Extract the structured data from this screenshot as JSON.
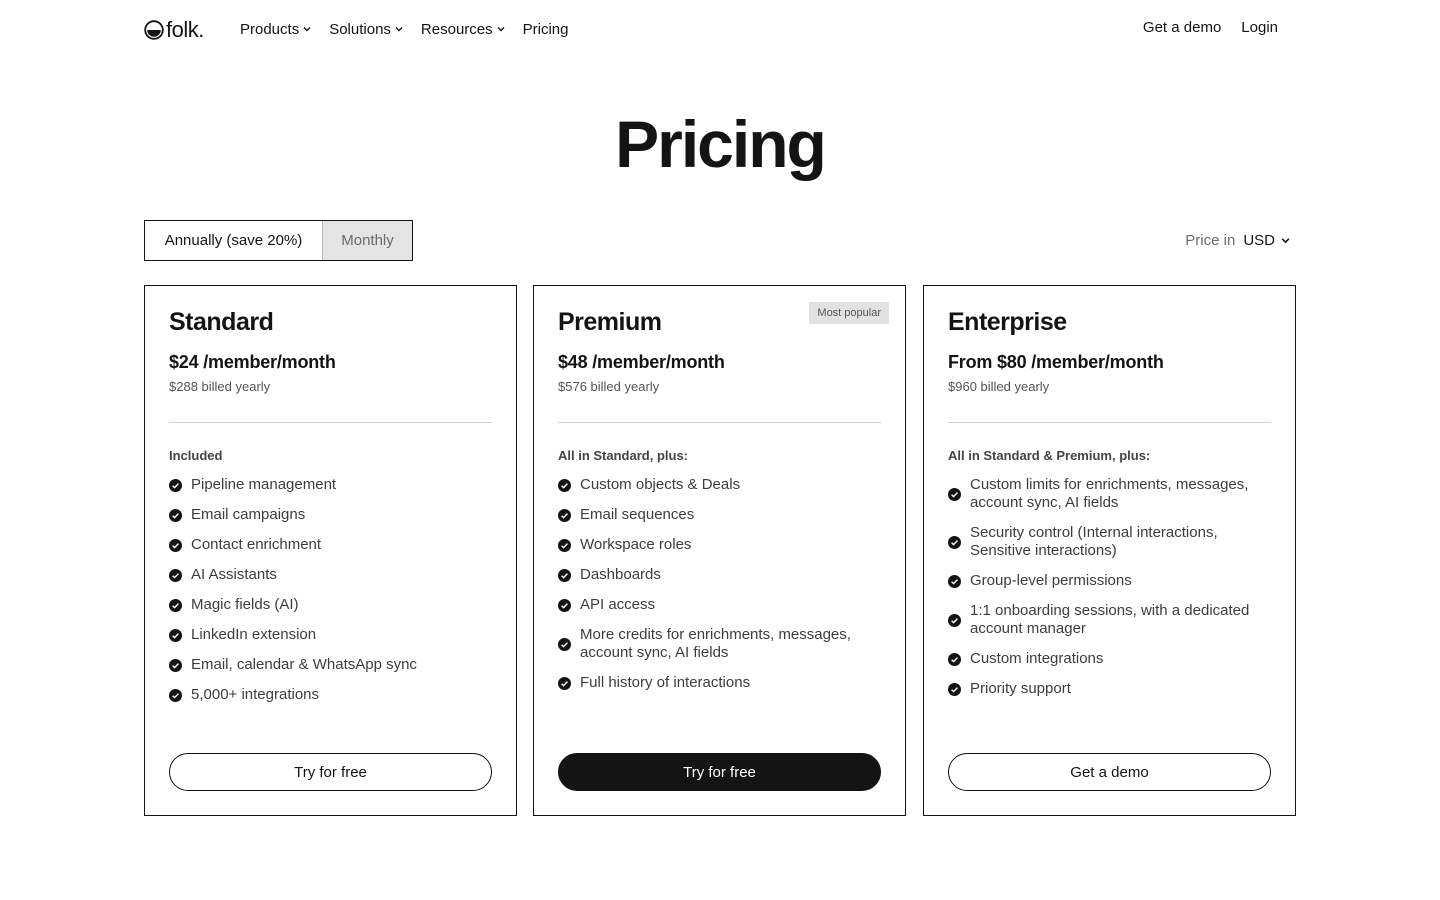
{
  "brand": {
    "logo_text": "folk."
  },
  "nav": {
    "items": [
      {
        "label": "Products",
        "has_dropdown": true
      },
      {
        "label": "Solutions",
        "has_dropdown": true
      },
      {
        "label": "Resources",
        "has_dropdown": true
      },
      {
        "label": "Pricing",
        "has_dropdown": false
      }
    ],
    "right": {
      "demo": "Get a demo",
      "login": "Login"
    }
  },
  "page": {
    "title": "Pricing"
  },
  "billing_toggle": {
    "annual": "Annually (save 20%)",
    "monthly": "Monthly",
    "selected": "annual"
  },
  "currency": {
    "label": "Price in",
    "value": "USD"
  },
  "plans": [
    {
      "name": "Standard",
      "price": "$24 /member/month",
      "billed": "$288 billed yearly",
      "features_heading": "Included",
      "features": [
        "Pipeline management",
        "Email campaigns",
        "Contact enrichment",
        "AI Assistants",
        "Magic fields (AI)",
        "LinkedIn extension",
        "Email, calendar & WhatsApp sync",
        "5,000+ integrations"
      ],
      "cta": "Try for free"
    },
    {
      "name": "Premium",
      "badge": "Most popular",
      "price": "$48 /member/month",
      "billed": "$576 billed yearly",
      "features_heading": "All in Standard, plus:",
      "features": [
        "Custom objects & Deals",
        "Email sequences",
        "Workspace roles",
        "Dashboards",
        "API access",
        "More credits for enrichments, messages, account sync, AI fields",
        "Full history of interactions"
      ],
      "cta": "Try for free"
    },
    {
      "name": "Enterprise",
      "price": "From $80 /member/month",
      "billed": "$960 billed yearly",
      "features_heading": "All in Standard & Premium, plus:",
      "features": [
        "Custom limits for enrichments, messages, account sync, AI fields",
        "Security control (Internal interactions, Sensitive interactions)",
        "Group-level permissions",
        "1:1 onboarding sessions, with a dedicated account manager",
        "Custom integrations",
        "Priority support"
      ],
      "cta": "Get a demo"
    }
  ],
  "colors": {
    "text": "#141414",
    "muted": "#6b6b6b",
    "toggle_inactive_bg": "#e4e4e4",
    "badge_bg": "#e2e2e2",
    "cta_dark": "#141414"
  }
}
